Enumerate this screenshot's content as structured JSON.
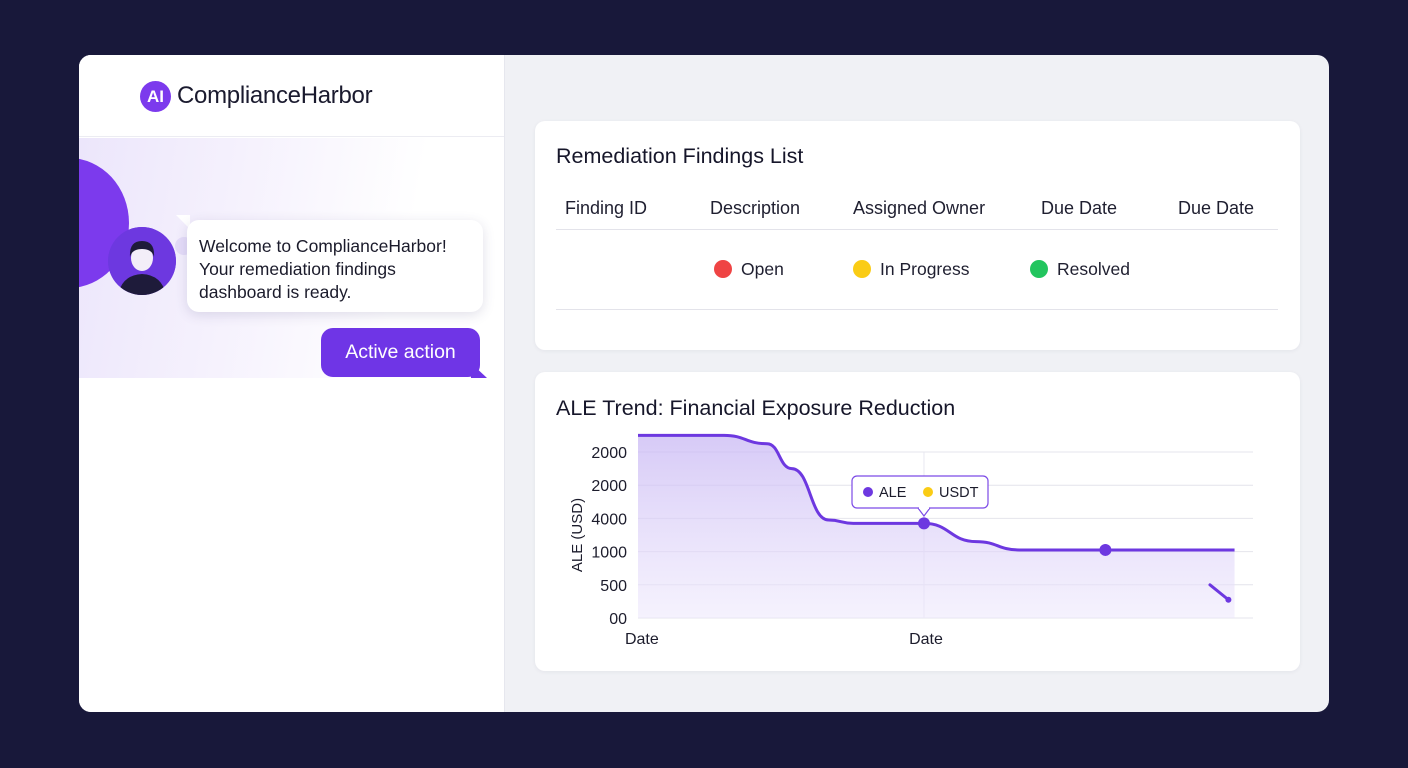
{
  "app": {
    "logo_text": "AI",
    "name": "ComplianceHarbor"
  },
  "chat": {
    "message": "Welcome to ComplianceHarbor! Your remediation findings dashboard is ready.",
    "action_label": "Active action"
  },
  "findings": {
    "title": "Remediation Findings List",
    "columns": [
      "Finding ID",
      "Description",
      "Assigned Owner",
      "Due Date",
      "Due Date"
    ],
    "status_legend": [
      {
        "label": "Open",
        "color": "#ef4444"
      },
      {
        "label": "In Progress",
        "color": "#facc15"
      },
      {
        "label": "Resolved",
        "color": "#22c55e"
      }
    ]
  },
  "chart": {
    "title": "ALE Trend: Financial Exposure Reduction"
  },
  "chart_data": {
    "type": "area",
    "title": "ALE Trend: Financial Exposure Reduction",
    "ylabel": "ALE (USD)",
    "yticks": [
      "2000",
      "2000",
      "4000",
      "1000",
      "500",
      "00"
    ],
    "xticks": [
      "Date",
      "Date"
    ],
    "grid": true,
    "legend_position": "top-center",
    "legend": [
      {
        "name": "ALE",
        "color": "#6d38e0"
      },
      {
        "name": "USDT",
        "color": "#facc15"
      }
    ],
    "series": [
      {
        "name": "ALE",
        "color": "#6d38e0",
        "points": [
          {
            "x": 0.0,
            "y": 5.5
          },
          {
            "x": 0.14,
            "y": 5.5
          },
          {
            "x": 0.21,
            "y": 5.25
          },
          {
            "x": 0.25,
            "y": 4.5
          },
          {
            "x": 0.31,
            "y": 2.95
          },
          {
            "x": 0.35,
            "y": 2.85
          },
          {
            "x": 0.465,
            "y": 2.85,
            "marker": true
          },
          {
            "x": 0.55,
            "y": 2.3
          },
          {
            "x": 0.62,
            "y": 2.05
          },
          {
            "x": 0.76,
            "y": 2.05,
            "marker": true
          },
          {
            "x": 0.97,
            "y": 2.05
          }
        ]
      },
      {
        "name": "ALE",
        "color": "#6d38e0",
        "points": [
          {
            "x": 0.93,
            "y": 1.0
          },
          {
            "x": 0.96,
            "y": 0.55
          }
        ]
      }
    ],
    "xlim": [
      0,
      1
    ],
    "ylim": [
      0,
      5
    ]
  }
}
